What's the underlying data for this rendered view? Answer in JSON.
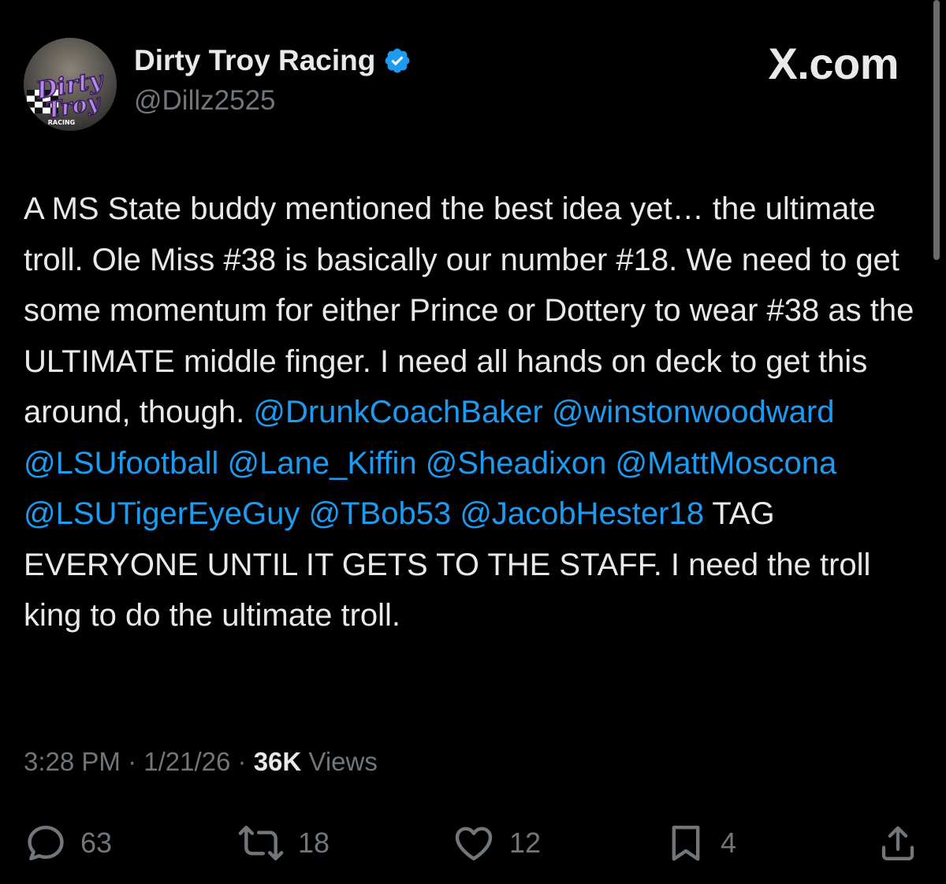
{
  "header": {
    "display_name": "Dirty Troy Racing",
    "handle": "@Dillz2525",
    "brand": "X.com",
    "avatar_text": [
      "Dirty",
      "Troy",
      "RACING"
    ]
  },
  "tweet": {
    "text_1": "A MS State buddy mentioned the best idea yet… the ultimate troll. Ole Miss #38 is basically our number #18. We need to get some momentum for either Prince or Dottery to wear #38 as the ULTIMATE middle finger. I need all hands on deck to get this around, though.",
    "mentions": [
      "@DrunkCoachBaker",
      "@winstonwoodward",
      "@LSUfootball",
      "@Lane_Kiffin",
      "@Sheadixon",
      "@MattMoscona",
      "@LSUTigerEyeGuy",
      "@TBob53",
      "@JacobHester18"
    ],
    "text_2": "TAG EVERYONE UNTIL IT GETS TO THE STAFF. I need the troll king to do the ultimate troll."
  },
  "meta": {
    "time": "3:28 PM",
    "separator": "·",
    "date": "1/21/26",
    "views_count": "36K",
    "views_label": "Views"
  },
  "actions": {
    "replies": "63",
    "reposts": "18",
    "likes": "12",
    "bookmarks": "4"
  },
  "colors": {
    "background": "#000000",
    "text": "#e7e9ea",
    "secondary": "#71767b",
    "accent": "#1d9bf0"
  },
  "icons": [
    "verified-badge-icon",
    "reply-icon",
    "repost-icon",
    "like-icon",
    "bookmark-icon",
    "share-icon"
  ]
}
